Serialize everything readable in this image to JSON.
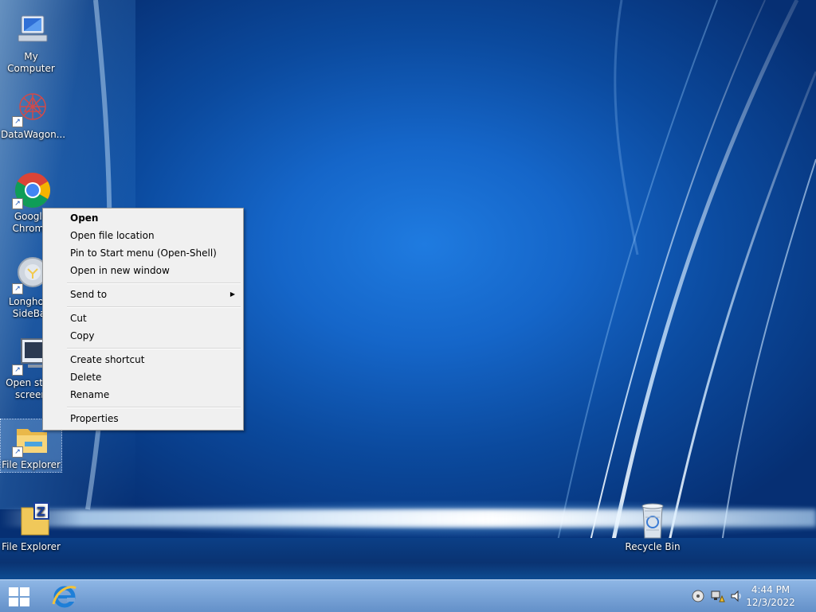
{
  "desktop": {
    "icons": [
      {
        "label": "My Computer",
        "icon": "computer-icon"
      },
      {
        "label": "DataWagon...",
        "icon": "datawagon-icon"
      },
      {
        "label": "Google Chrome",
        "line1": "Google",
        "line2": "Chrome",
        "icon": "chrome-icon"
      },
      {
        "label": "Longhorn SideBar",
        "line1": "Longhorn",
        "line2": "SideBar",
        "icon": "sidebar-icon"
      },
      {
        "label": "Open start screen",
        "line1": "Open start",
        "line2": "screen",
        "icon": "start-screen-icon"
      },
      {
        "label": "File Explorer",
        "icon": "folder-icon"
      },
      {
        "label": "File Explorer",
        "icon": "zip-folder-icon"
      },
      {
        "label": "Recycle Bin",
        "icon": "recycle-bin-icon"
      }
    ]
  },
  "context_menu": {
    "items": [
      {
        "label": "Open"
      },
      {
        "label": "Open file location"
      },
      {
        "label": "Pin to Start menu (Open-Shell)"
      },
      {
        "label": "Open in new window"
      },
      {
        "label": "Send to"
      },
      {
        "label": "Cut"
      },
      {
        "label": "Copy"
      },
      {
        "label": "Create shortcut"
      },
      {
        "label": "Delete"
      },
      {
        "label": "Rename"
      },
      {
        "label": "Properties"
      }
    ],
    "submenu_arrow": "▶"
  },
  "taskbar": {
    "start_icon": "windows-logo-icon",
    "pinned": [
      {
        "icon": "internet-explorer-icon"
      }
    ],
    "tray": [
      {
        "icon": "disc-icon"
      },
      {
        "icon": "network-warning-icon"
      },
      {
        "icon": "speaker-icon"
      }
    ],
    "clock": {
      "time": "4:44 PM",
      "date": "12/3/2022"
    }
  },
  "colors": {
    "desktop_blue": "#1566c9",
    "menu_background": "#f0f0f0",
    "taskbar": "#7aa5d8"
  }
}
